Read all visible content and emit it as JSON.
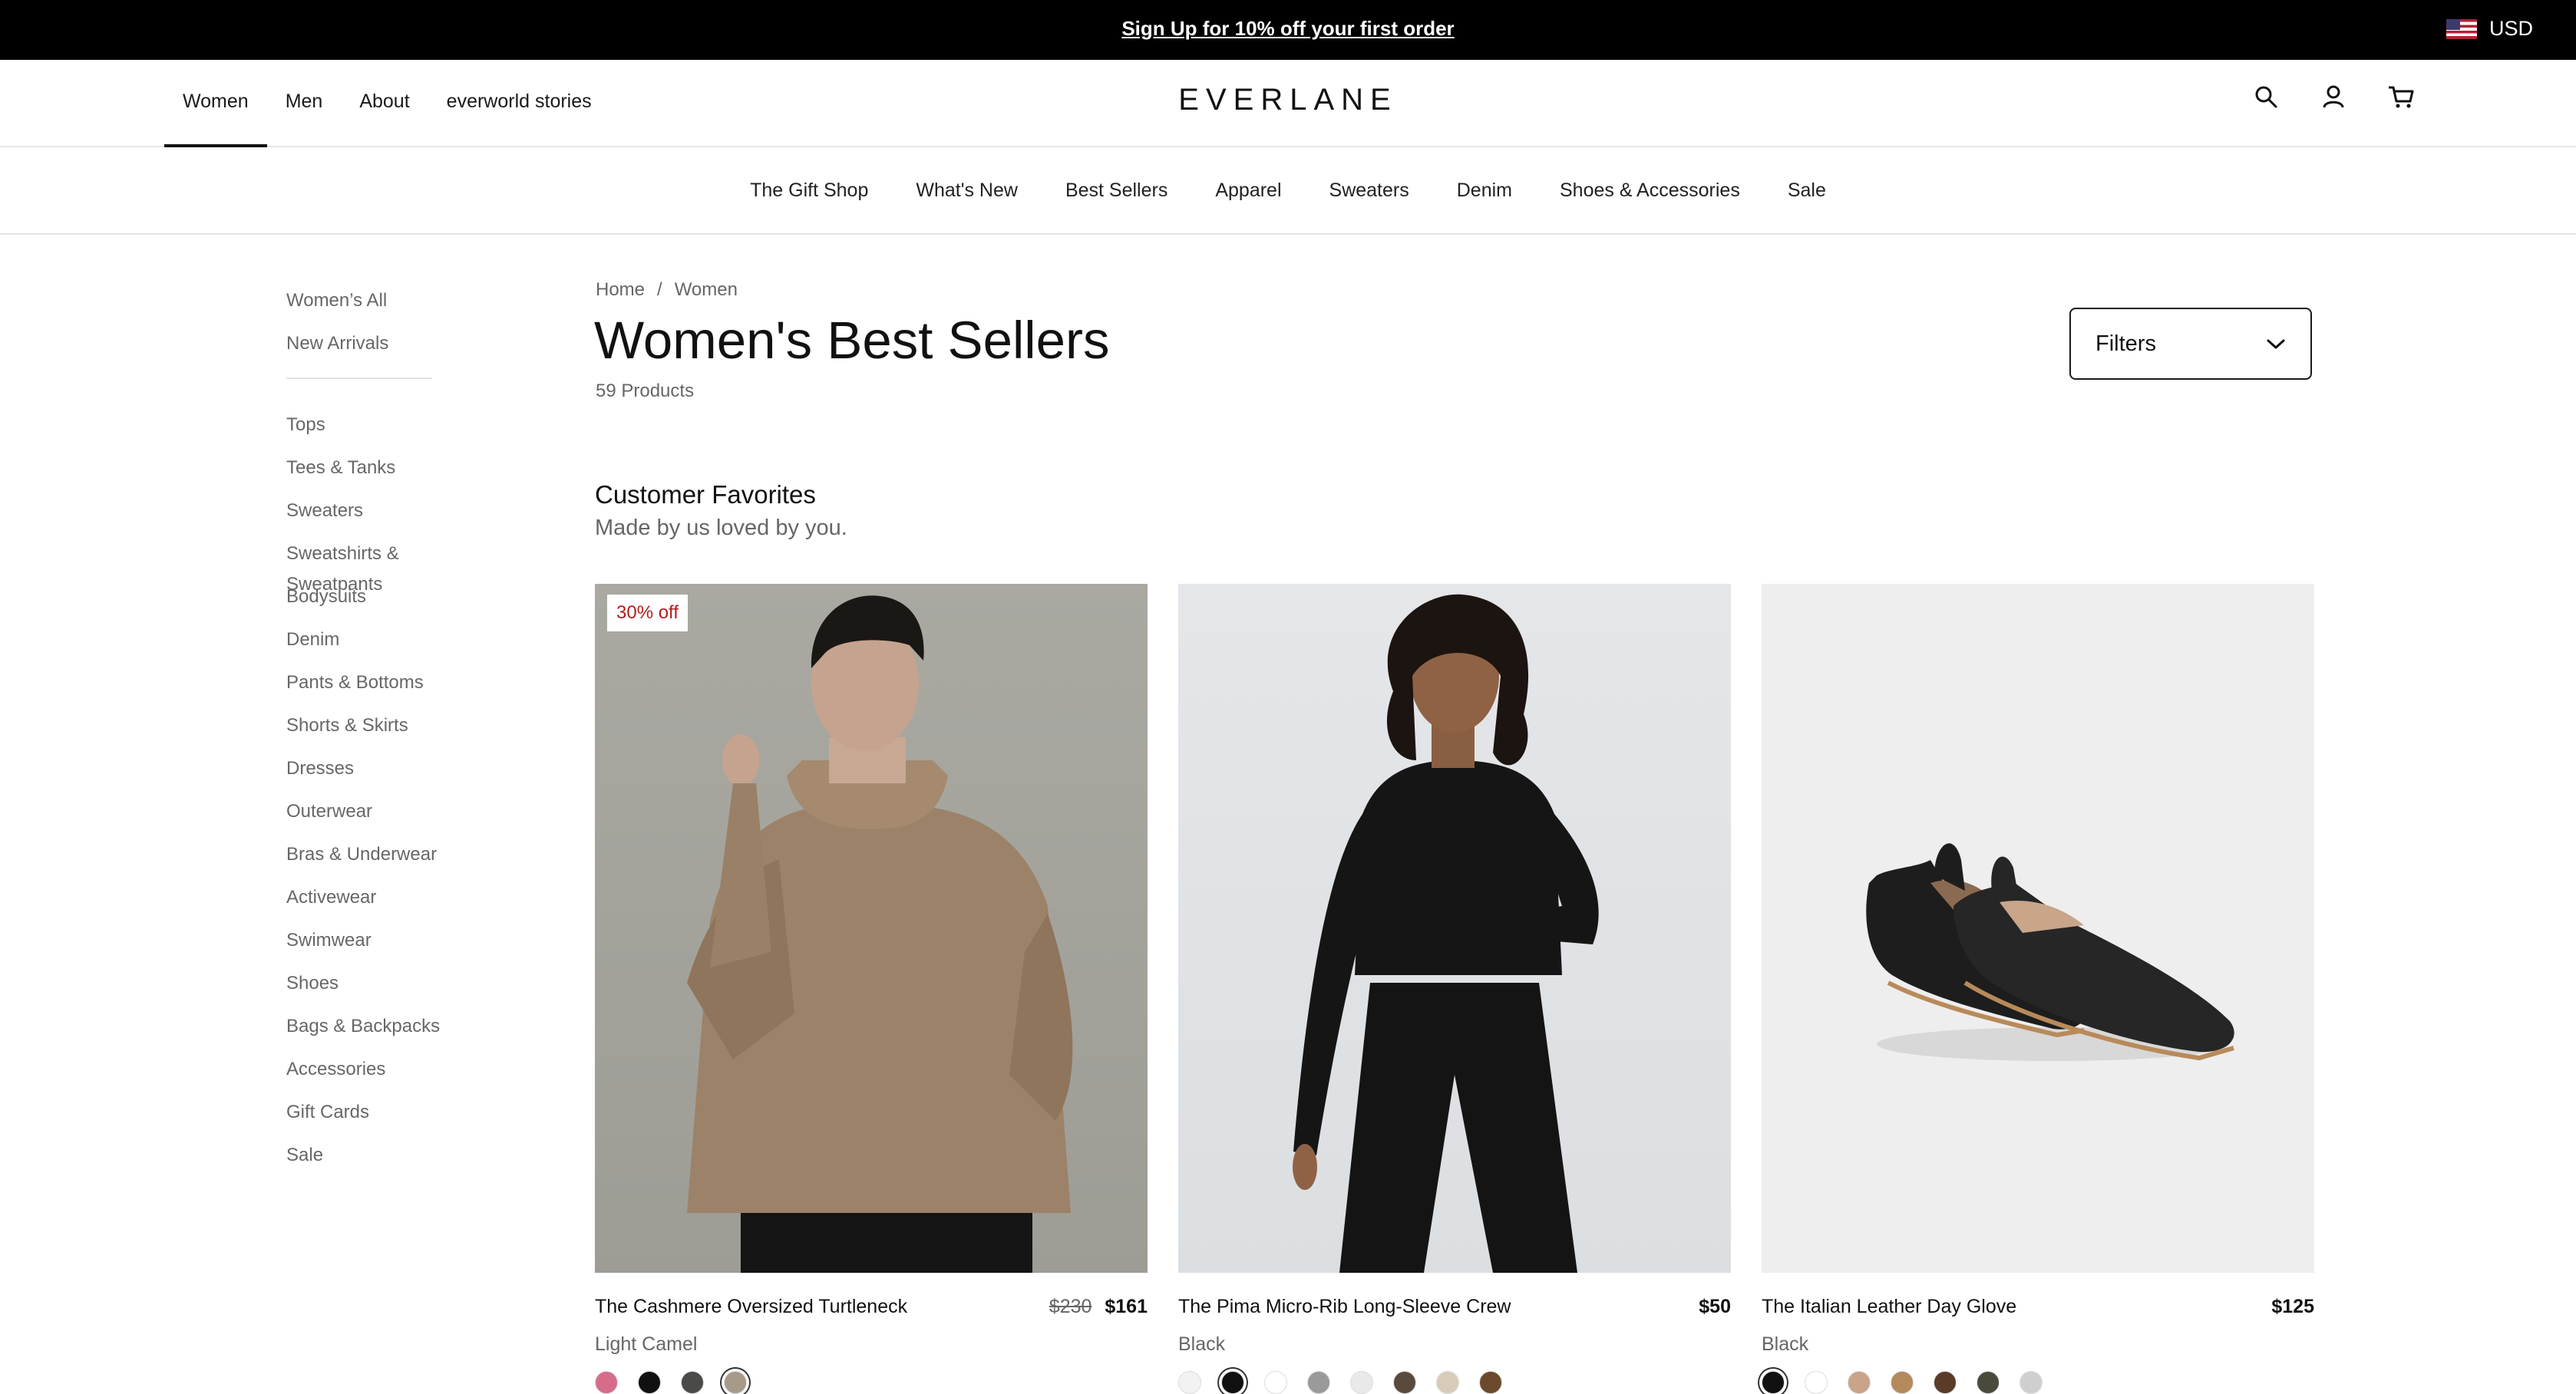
{
  "promo": {
    "text": "Sign Up for 10% off your first order",
    "currency": "USD",
    "flag_icon": "us-flag-icon"
  },
  "header": {
    "nav": [
      "Women",
      "Men",
      "About",
      "everworld stories"
    ],
    "active_nav": "Women",
    "logo": "EVERLANE",
    "icons": [
      "search-icon",
      "account-icon",
      "cart-icon"
    ]
  },
  "subnav": [
    "The Gift Shop",
    "What's New",
    "Best Sellers",
    "Apparel",
    "Sweaters",
    "Denim",
    "Shoes & Accessories",
    "Sale"
  ],
  "sidebar": {
    "top": [
      "Women’s All",
      "New Arrivals"
    ],
    "categories": [
      "Tops",
      "Tees & Tanks",
      "Sweaters",
      "Sweatshirts & Sweatpants",
      "Bodysuits",
      "Denim",
      "Pants & Bottoms",
      "Shorts & Skirts",
      "Dresses",
      "Outerwear",
      "Bras & Underwear",
      "Activewear",
      "Swimwear",
      "Shoes",
      "Bags & Backpacks",
      "Accessories",
      "Gift Cards",
      "Sale"
    ]
  },
  "breadcrumb": {
    "home": "Home",
    "sep": "/",
    "current": "Women"
  },
  "page": {
    "title": "Women's Best Sellers",
    "count": "59 Products",
    "filters_label": "Filters"
  },
  "section": {
    "title": "Customer Favorites",
    "subtitle": "Made by us loved by you."
  },
  "products": [
    {
      "name": "The Cashmere Oversized Turtleneck",
      "badge": "30% off",
      "price_old": "$230",
      "price": "$161",
      "color": "Light Camel",
      "swatches": [
        "#d76c8a",
        "#111111",
        "#4a4a48",
        "#a89a8a"
      ],
      "selected_swatch": 3
    },
    {
      "name": "The Pima Micro-Rib Long-Sleeve Crew",
      "badge": "",
      "price_old": "",
      "price": "$50",
      "color": "Black",
      "swatches": [
        "#f2f2f2",
        "#111111",
        "#ffffff",
        "#9a9a9a",
        "#e9e9e9",
        "#5a4a3e",
        "#d8ccb8",
        "#6b4a2b"
      ],
      "selected_swatch": 1
    },
    {
      "name": "The Italian Leather Day Glove",
      "badge": "",
      "price_old": "",
      "price": "$125",
      "color": "Black",
      "swatches": [
        "#111111",
        "#ffffff",
        "#c9a48a",
        "#b48a5c",
        "#5a3b28",
        "#4a4a3c",
        "#cfcfcf"
      ],
      "selected_swatch": 0
    }
  ]
}
